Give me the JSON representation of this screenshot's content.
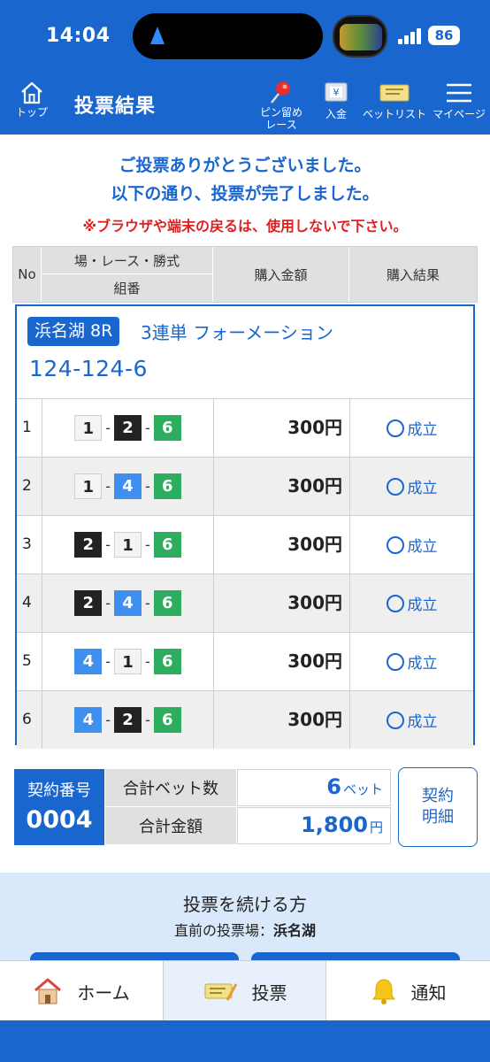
{
  "status_bar": {
    "time": "14:04",
    "battery": "86"
  },
  "header": {
    "home_label": "トップ",
    "title": "投票結果",
    "pin_label_1": "ピン留め",
    "pin_label_2": "レース",
    "deposit_label": "入金",
    "betlist_label": "ベットリスト",
    "mypage_label": "マイページ"
  },
  "message": {
    "line1": "ご投票ありがとうございました。",
    "line2": "以下の通り、投票が完了しました。",
    "warning": "※ブラウザや端末の戻るは、使用しないで下さい。"
  },
  "table_header": {
    "no": "No",
    "race": "場・レース・勝式",
    "combo": "組番",
    "amount": "購入金額",
    "result": "購入結果"
  },
  "bet": {
    "venue": "浜名湖 8R",
    "type": "3連単 フォーメーション",
    "combination": "124-124-6",
    "rows": [
      {
        "no": "1",
        "boats": [
          "1",
          "2",
          "6"
        ],
        "amount": "300円",
        "result": "成立"
      },
      {
        "no": "2",
        "boats": [
          "1",
          "4",
          "6"
        ],
        "amount": "300円",
        "result": "成立"
      },
      {
        "no": "3",
        "boats": [
          "2",
          "1",
          "6"
        ],
        "amount": "300円",
        "result": "成立"
      },
      {
        "no": "4",
        "boats": [
          "2",
          "4",
          "6"
        ],
        "amount": "300円",
        "result": "成立"
      },
      {
        "no": "5",
        "boats": [
          "4",
          "1",
          "6"
        ],
        "amount": "300円",
        "result": "成立"
      },
      {
        "no": "6",
        "boats": [
          "4",
          "2",
          "6"
        ],
        "amount": "300円",
        "result": "成立"
      }
    ]
  },
  "summary": {
    "contract_label": "契約番号",
    "contract_number": "0004",
    "bet_count_label": "合計ベット数",
    "bet_count": "6",
    "bet_count_unit": "ベット",
    "total_label": "合計金額",
    "total": "1,800",
    "total_unit": "円",
    "detail_1": "契約",
    "detail_2": "明細"
  },
  "continue": {
    "title": "投票を続ける方",
    "prev_label": "直前の投票場：",
    "prev_venue": "浜名湖"
  },
  "bottom_nav": {
    "home": "ホーム",
    "vote": "投票",
    "notify": "通知"
  },
  "colors": {
    "primary": "#1a66cf",
    "warning": "#e02020",
    "boat1": "#f4f4f4",
    "boat2": "#222222",
    "boat4": "#3f8ff0",
    "boat6": "#2cae5e"
  }
}
